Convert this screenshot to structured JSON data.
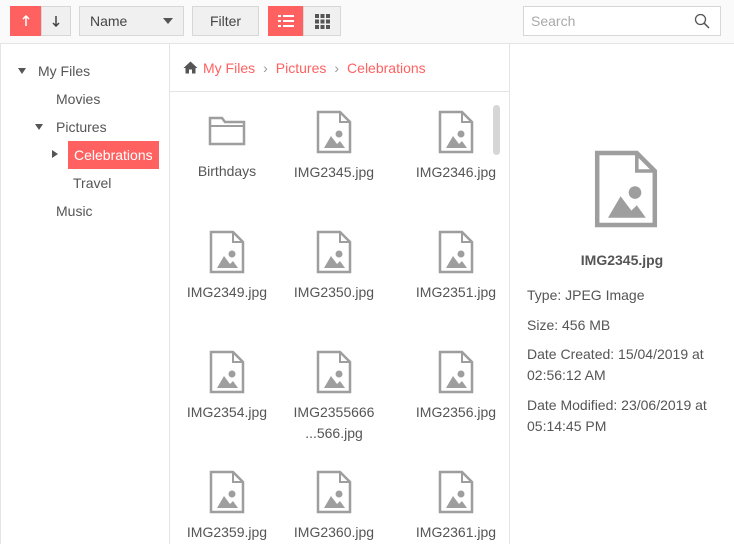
{
  "toolbar": {
    "sort_field": "Name",
    "filter_label": "Filter",
    "search_placeholder": "Search",
    "accent_color": "#ff6161"
  },
  "tree": {
    "items": [
      {
        "label": "My Files",
        "expanded": true
      },
      {
        "label": "Movies"
      },
      {
        "label": "Pictures",
        "expanded": true
      },
      {
        "label": "Celebrations",
        "selected": true,
        "collapsed": true
      },
      {
        "label": "Travel"
      },
      {
        "label": "Music"
      }
    ]
  },
  "breadcrumb": {
    "items": [
      "My Files",
      "Pictures",
      "Celebrations"
    ],
    "separator": "›"
  },
  "files": [
    {
      "label": "Birthdays",
      "type": "folder"
    },
    {
      "label": "IMG2345.jpg",
      "type": "image"
    },
    {
      "label": "IMG2346.jpg",
      "type": "image"
    },
    {
      "label": "IMG2349.jpg",
      "type": "image"
    },
    {
      "label": "IMG2350.jpg",
      "type": "image"
    },
    {
      "label": "IMG2351.jpg",
      "type": "image"
    },
    {
      "label": "IMG2354.jpg",
      "type": "image"
    },
    {
      "label_line1": "IMG2355666",
      "label_line2": "...566.jpg",
      "type": "image"
    },
    {
      "label": "IMG2356.jpg",
      "type": "image"
    },
    {
      "label": "IMG2359.jpg",
      "type": "image"
    },
    {
      "label": "IMG2360.jpg",
      "type": "image"
    },
    {
      "label": "IMG2361.jpg",
      "type": "image"
    }
  ],
  "details": {
    "name": "IMG2345.jpg",
    "type_line": "Type: JPEG Image",
    "size_line": "Size: 456 MB",
    "created_line1": "Date Created: 15/04/2019 at",
    "created_line2": "02:56:12 AM",
    "modified_line1": "Date Modified: 23/06/2019 at",
    "modified_line2": "05:14:45 PM"
  }
}
